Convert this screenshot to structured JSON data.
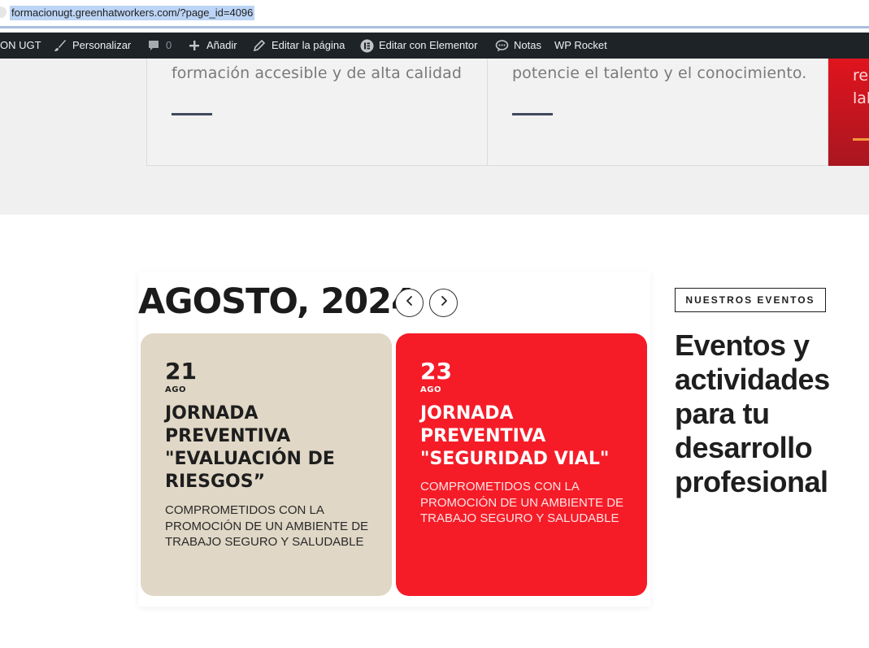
{
  "browser": {
    "url": "formacionugt.greenhatworkers.com/?page_id=4096"
  },
  "adminbar": {
    "site_name": "ON UGT",
    "customize": "Personalizar",
    "comments_count": "0",
    "add_new": "Añadir",
    "edit_page": "Editar la página",
    "edit_elementor": "Editar con Elementor",
    "notes": "Notas",
    "wp_rocket": "WP Rocket"
  },
  "features": [
    {
      "text": "formación accesible y de alta calidad"
    },
    {
      "text": "potencie el talento y el conocimiento."
    },
    {
      "text": "res\nlab"
    }
  ],
  "calendar": {
    "title": "AGOSTO, 2024",
    "prev_icon": "chevron-left-icon",
    "next_icon": "chevron-right-icon",
    "events": [
      {
        "day": "21",
        "month": "AGO",
        "title": "JORNADA PREVENTIVA \"EVALUACIÓN DE RIESGOS”",
        "description": "COMPROMETIDOS CON LA PROMOCIÓN DE UN AMBIENTE DE TRABAJO SEGURO Y SALUDABLE",
        "color": "#e0d7c6"
      },
      {
        "day": "23",
        "month": "AGO",
        "title": "JORNADA PREVENTIVA \"SEGURIDAD VIAL\"",
        "description": "COMPROMETIDOS CON LA PROMOCIÓN DE UN AMBIENTE DE TRABAJO SEGURO Y SALUDABLE",
        "color": "#f51c28"
      }
    ]
  },
  "events_section": {
    "badge": "NUESTROS EVENTOS",
    "heading": "Eventos y actividades para tu desarrollo profesional"
  },
  "colors": {
    "adminbar_bg": "#1d2327",
    "accent_red": "#f51c28",
    "beige": "#e0d7c6",
    "line_dark": "#3e4a5e",
    "orange": "#f59a3a"
  }
}
